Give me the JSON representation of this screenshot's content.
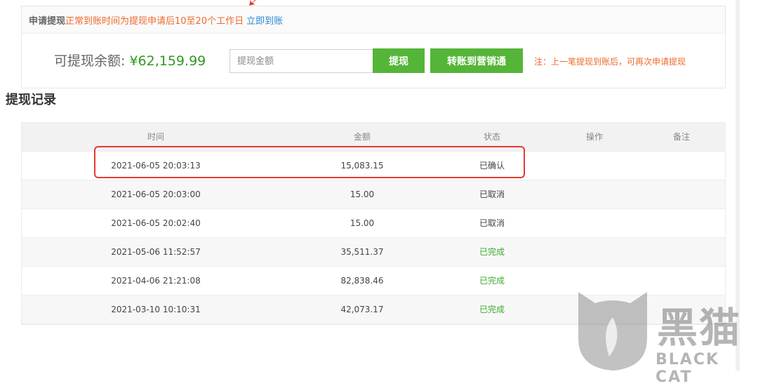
{
  "header": {
    "title": "申请提现",
    "notice": "正常到账时间为提现申请后10至20个工作日",
    "link": "立即到账"
  },
  "withdraw": {
    "balance_label": "可提现余额: ",
    "balance_value": "¥62,159.99",
    "amount_placeholder": "提现金额",
    "withdraw_button": "提现",
    "transfer_button": "转账到营销通",
    "tip": "注：上一笔提现到账后，可再次申请提现"
  },
  "records": {
    "title": "提现记录",
    "columns": [
      "时间",
      "金额",
      "状态",
      "操作",
      "备注"
    ],
    "rows": [
      {
        "time": "2021-06-05 20:03:13",
        "amount": "15,083.15",
        "status": "已确认",
        "done": false
      },
      {
        "time": "2021-06-05 20:03:00",
        "amount": "15.00",
        "status": "已取消",
        "done": false
      },
      {
        "time": "2021-06-05 20:02:40",
        "amount": "15.00",
        "status": "已取消",
        "done": false
      },
      {
        "time": "2021-05-06 11:52:57",
        "amount": "35,511.37",
        "status": "已完成",
        "done": true
      },
      {
        "time": "2021-04-06 21:21:08",
        "amount": "82,838.46",
        "status": "已完成",
        "done": true
      },
      {
        "time": "2021-03-10 10:10:31",
        "amount": "42,073.17",
        "status": "已完成",
        "done": true
      }
    ]
  },
  "watermark": {
    "text": "黑猫",
    "subtext": "BLACK CAT"
  },
  "colors": {
    "accent_green": "#55b538",
    "notice_orange": "#ee6a2c",
    "link_blue": "#2a8ad4",
    "highlight_red": "#e53a2e"
  }
}
